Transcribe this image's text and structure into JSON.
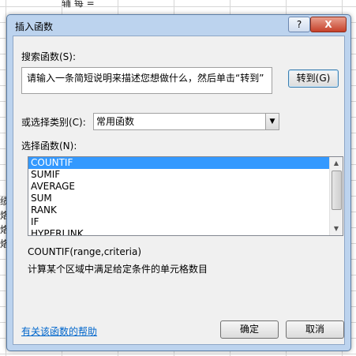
{
  "sheet": {
    "top_text": "辅 每 =",
    "left_text": "绩 烙 烙 烙"
  },
  "dialog": {
    "title": "插入函数",
    "help_button": "?",
    "close_button": "X",
    "search_label": "搜索函数(S):",
    "search_value": "请输入一条简短说明来描述您想做什么，然后单击“转到”",
    "go_button": "转到(G)",
    "category_label": "或选择类别(C):",
    "category_selected": "常用函数",
    "function_list_label": "选择函数(N):",
    "functions": [
      "COUNTIF",
      "SUMIF",
      "AVERAGE",
      "SUM",
      "RANK",
      "IF",
      "HYPERLINK"
    ],
    "selected_function": "COUNTIF",
    "syntax": "COUNTIF(range,criteria)",
    "description": "计算某个区域中满足给定条件的单元格数目",
    "help_link": "有关该函数的帮助",
    "ok_button": "确定",
    "cancel_button": "取消"
  }
}
